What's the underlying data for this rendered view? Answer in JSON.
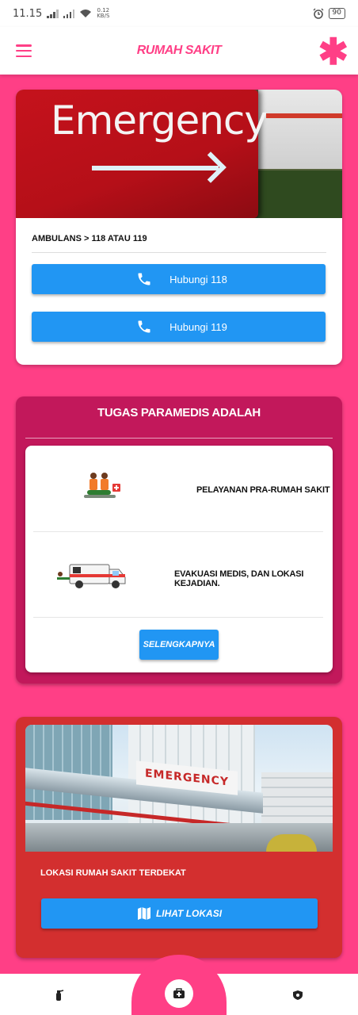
{
  "status_bar": {
    "time": "11.15",
    "net_speed_value": "0.12",
    "net_speed_unit": "KB/S",
    "battery": "90"
  },
  "app_bar": {
    "title": "RUMAH SAKIT"
  },
  "emergency_card": {
    "photo_sign_text": "Emergency",
    "ambulans_text": "AMBULANS > 118 ATAU 119",
    "call_118_label": "Hubungi 118",
    "call_119_label": "Hubungi 119"
  },
  "paramedic_card": {
    "title": "TUGAS PARAMEDIS ADALAH",
    "tasks": [
      {
        "label": "PELAYANAN PRA-RUMAH SAKIT",
        "icon": "paramedics-icon"
      },
      {
        "label": "EVAKUASI MEDIS, DAN LOKASI KEJADIAN.",
        "icon": "ambulance-icon"
      }
    ],
    "more_label": "SELENGKAPNYA"
  },
  "hospital_card": {
    "photo_sign_text": "EMERGENCY",
    "location_text": "LOKASI RUMAH SAKIT TERDEKAT",
    "view_label": "LIHAT LOKASI"
  },
  "bottom_nav": [
    "fire-extinguisher-icon",
    "first-aid-kit-icon",
    "police-badge-icon"
  ],
  "colors": {
    "primary": "#ff3f86",
    "magenta": "#c2185b",
    "red": "#d32f2f",
    "button_blue": "#2196f3"
  }
}
